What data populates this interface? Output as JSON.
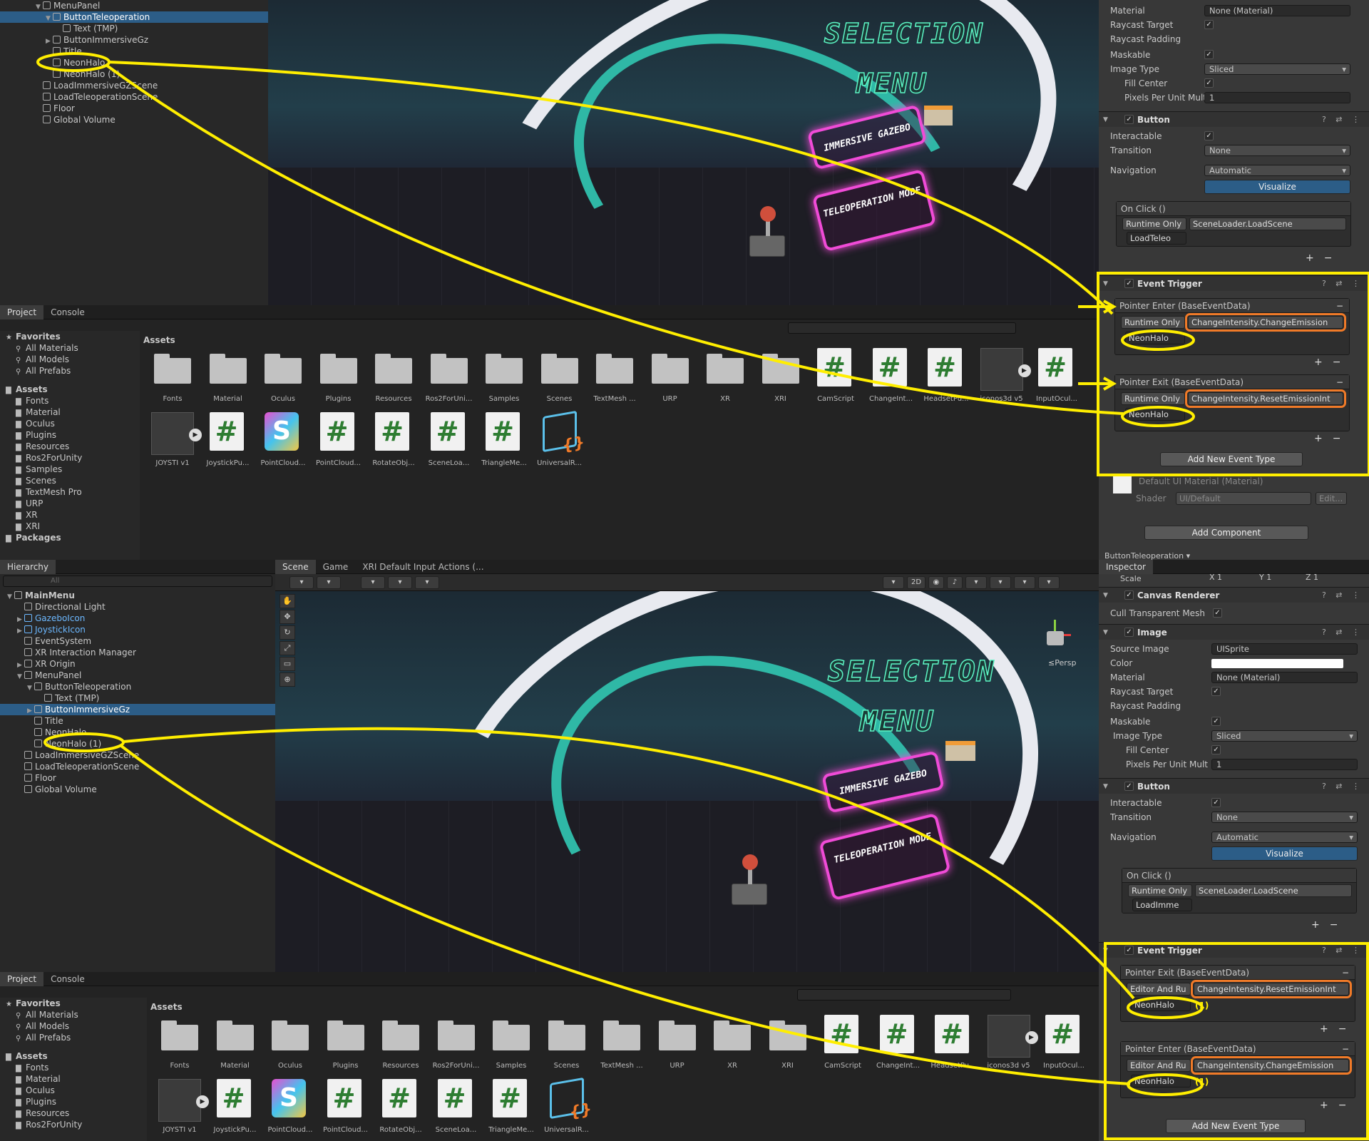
{
  "top": {
    "hierarchy": [
      {
        "label": "MenuPanel",
        "depth": 2,
        "expanded": true
      },
      {
        "label": "ButtonTeleoperation",
        "depth": 3,
        "expanded": true,
        "selected": true
      },
      {
        "label": "Text (TMP)",
        "depth": 4
      },
      {
        "label": "ButtonImmersiveGz",
        "depth": 3,
        "collapsed": true
      },
      {
        "label": "Title",
        "depth": 3
      },
      {
        "label": "NeonHalo",
        "depth": 3
      },
      {
        "label": "NeonHalo (1)",
        "depth": 3
      },
      {
        "label": "LoadImmersiveGZScene",
        "depth": 2
      },
      {
        "label": "LoadTeleoperationScene",
        "depth": 2
      },
      {
        "label": "Floor",
        "depth": 2
      },
      {
        "label": "Global Volume",
        "depth": 2
      }
    ],
    "tabs": {
      "project": "Project",
      "console": "Console"
    },
    "favorites": {
      "header": "Favorites",
      "items": [
        "All Materials",
        "All Models",
        "All Prefabs"
      ]
    },
    "assets_tree": {
      "header": "Assets",
      "items": [
        "Fonts",
        "Material",
        "Oculus",
        "Plugins",
        "Resources",
        "Ros2ForUnity",
        "Samples",
        "Scenes",
        "TextMesh Pro",
        "URP",
        "XR",
        "XRI"
      ],
      "packages": "Packages"
    },
    "assets_header": "Assets",
    "inspector": {
      "material_label": "Material",
      "material_value": "None (Material)",
      "raycast_target": "Raycast Target",
      "raycast_padding": "Raycast Padding",
      "maskable": "Maskable",
      "image_type": "Image Type",
      "image_type_value": "Sliced",
      "fill_center": "Fill Center",
      "ppu": "Pixels Per Unit Mult",
      "ppu_value": "1",
      "button_title": "Button",
      "interactable": "Interactable",
      "transition": "Transition",
      "transition_value": "None",
      "navigation": "Navigation",
      "navigation_value": "Automatic",
      "visualize": "Visualize",
      "on_click": "On Click ()",
      "runtime": "Runtime Only",
      "onclick_fn": "SceneLoader.LoadScene",
      "onclick_obj": "LoadTeleo",
      "event_trigger": "Event Trigger",
      "events": [
        {
          "head": "Pointer Enter (BaseEventData)",
          "mode": "Runtime Only",
          "fn": "ChangeIntensity.ChangeEmission",
          "obj": "NeonHalo"
        },
        {
          "head": "Pointer Exit (BaseEventData)",
          "mode": "Runtime Only",
          "fn": "ChangeIntensity.ResetEmissionInt",
          "obj": "NeonHalo"
        }
      ],
      "add_event": "Add New Event Type",
      "default_mat": "Default UI Material (Material)",
      "shader": "Shader",
      "shader_value": "UI/Default",
      "edit": "Edit...",
      "add_component": "Add Component",
      "footer": "ButtonTeleoperation ▾"
    }
  },
  "bottom": {
    "tabs": {
      "hierarchy": "Hierarchy",
      "scene": "Scene",
      "game": "Game",
      "xri": "XRI Default Input Actions (...",
      "inspector": "Inspector",
      "project": "Project",
      "console": "Console"
    },
    "search_placeholder": "All",
    "hierarchy": [
      {
        "label": "MainMenu",
        "depth": 0,
        "expanded": true,
        "bold": true
      },
      {
        "label": "Directional Light",
        "depth": 1
      },
      {
        "label": "GazeboIcon",
        "depth": 1,
        "blue": true,
        "collapsed": true
      },
      {
        "label": "JoystickIcon",
        "depth": 1,
        "blue": true,
        "collapsed": true
      },
      {
        "label": "EventSystem",
        "depth": 1
      },
      {
        "label": "XR Interaction Manager",
        "depth": 1
      },
      {
        "label": "XR Origin",
        "depth": 1,
        "collapsed": true
      },
      {
        "label": "MenuPanel",
        "depth": 1,
        "expanded": true
      },
      {
        "label": "ButtonTeleoperation",
        "depth": 2,
        "expanded": true
      },
      {
        "label": "Text (TMP)",
        "depth": 3
      },
      {
        "label": "ButtonImmersiveGz",
        "depth": 2,
        "collapsed": true,
        "selected": true
      },
      {
        "label": "Title",
        "depth": 2
      },
      {
        "label": "NeonHalo",
        "depth": 2
      },
      {
        "label": "NeonHalo (1)",
        "depth": 2
      },
      {
        "label": "LoadImmersiveGZScene",
        "depth": 1
      },
      {
        "label": "LoadTeleoperationScene",
        "depth": 1
      },
      {
        "label": "Floor",
        "depth": 1
      },
      {
        "label": "Global Volume",
        "depth": 1
      }
    ],
    "scene_persp": "≤Persp",
    "favorites": {
      "header": "Favorites",
      "items": [
        "All Materials",
        "All Models",
        "All Prefabs"
      ]
    },
    "assets_tree": {
      "header": "Assets",
      "items": [
        "Fonts",
        "Material",
        "Oculus",
        "Plugins",
        "Resources",
        "Ros2ForUnity"
      ]
    },
    "assets_header": "Assets",
    "inspector": {
      "scale": "Scale",
      "scale_x": "X 1",
      "scale_y": "Y 1",
      "scale_z": "Z 1",
      "canvas_renderer": "Canvas Renderer",
      "cull": "Cull Transparent Mesh",
      "image_title": "Image",
      "source_image": "Source Image",
      "source_value": "UISprite",
      "color": "Color",
      "material_label": "Material",
      "material_value": "None (Material)",
      "raycast_target": "Raycast Target",
      "raycast_padding": "Raycast Padding",
      "maskable": "Maskable",
      "image_type": "Image Type",
      "image_type_value": "Sliced",
      "fill_center": "Fill Center",
      "ppu": "Pixels Per Unit Mult",
      "ppu_value": "1",
      "button_title": "Button",
      "interactable": "Interactable",
      "transition": "Transition",
      "transition_value": "None",
      "navigation": "Navigation",
      "navigation_value": "Automatic",
      "visualize": "Visualize",
      "on_click": "On Click ()",
      "runtime": "Runtime Only",
      "onclick_fn": "SceneLoader.LoadScene",
      "onclick_obj": "LoadImme",
      "event_trigger": "Event Trigger",
      "events": [
        {
          "head": "Pointer Exit (BaseEventData)",
          "mode": "Editor And Ru",
          "fn": "ChangeIntensity.ResetEmissionInt",
          "obj": "NeonHalo"
        },
        {
          "head": "Pointer Enter (BaseEventData)",
          "mode": "Editor And Ru",
          "fn": "ChangeIntensity.ChangeEmission",
          "obj": "NeonHalo"
        }
      ],
      "annot": "(1)",
      "add_event": "Add New Event Type"
    },
    "toolbar_2d": "2D"
  },
  "scene_text": {
    "title1": "SELECTION",
    "title2": "MENU",
    "btn1": "IMMERSIVE GAZEBO",
    "btn2": "TELEOPERATION MODE"
  },
  "assets_row1": [
    "Fonts",
    "Material",
    "Oculus",
    "Plugins",
    "Resources",
    "Ros2ForUni...",
    "Samples",
    "Scenes",
    "TextMesh ...",
    "URP",
    "XR",
    "XRI",
    "CamScript",
    "ChangeInt...",
    "HeadsetPu...",
    "iconos3d v5",
    "InputOcul..."
  ],
  "assets_row2": [
    "JOYSTI v1",
    "JoystickPu...",
    "PointCloud...",
    "PointCloud...",
    "RotateObj...",
    "SceneLoa...",
    "TriangleMe...",
    "UniversalR..."
  ],
  "colors": {
    "selection": "#2c5d87",
    "highlight_yellow": "#ffee00",
    "highlight_orange": "#f07a28",
    "neon_pink": "#f04bd7",
    "neon_green": "#5cf4c4"
  }
}
